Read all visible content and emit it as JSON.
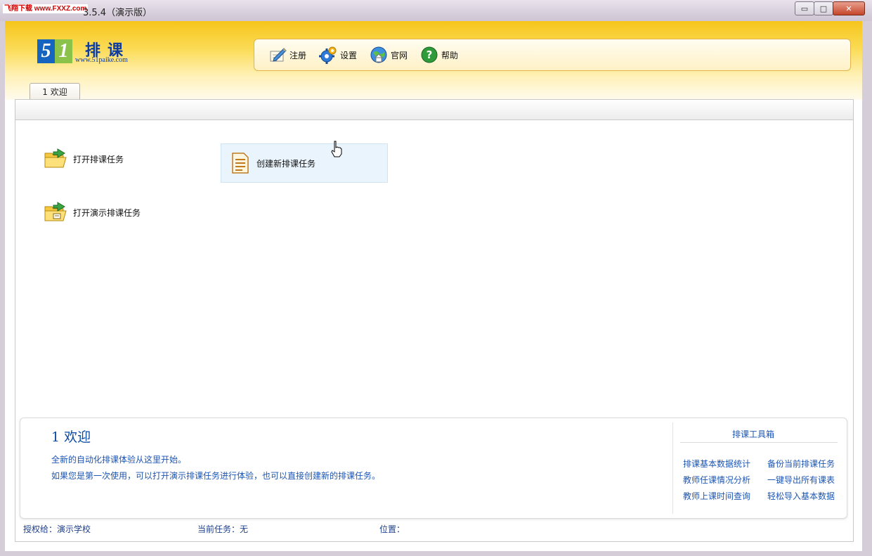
{
  "window": {
    "watermark": "飞翔下载 www.FXXZ.com",
    "title": "3.5.4（演示版）",
    "btn_min": "▭",
    "btn_max": "□",
    "btn_close": "✕"
  },
  "logo": {
    "digit1": "5",
    "digit2": "1",
    "name": "排课",
    "url": "www.51paike.com"
  },
  "toolbar": {
    "items": [
      {
        "label": "注册",
        "icon": "register-pencil-icon"
      },
      {
        "label": "设置",
        "icon": "gear-icon"
      },
      {
        "label": "官网",
        "icon": "globe-home-icon"
      },
      {
        "label": "帮助",
        "icon": "help-icon"
      }
    ]
  },
  "tabs": [
    {
      "label": "1 欢迎",
      "active": true
    }
  ],
  "tasks": {
    "open_task": "打开排课任务",
    "new_task": "创建新排课任务",
    "open_demo": "打开演示排课任务"
  },
  "info": {
    "title": "1  欢迎",
    "line1": "全新的自动化排课体验从这里开始。",
    "line2": "如果您是第一次使用，可以打开演示排课任务进行体验，也可以直接创建新的排课任务。"
  },
  "toolbox": {
    "title": "排课工具箱",
    "links": [
      "排课基本数据统计",
      "备份当前排课任务",
      "教师任课情况分析",
      "一键导出所有课表",
      "教师上课时间查询",
      "轻松导入基本数据"
    ]
  },
  "status": {
    "licensed": "授权给：演示学校",
    "current_task": "当前任务：无",
    "location": "位置："
  },
  "colors": {
    "header_top": "#f6c51b",
    "link_blue": "#1d56b3",
    "title_blue": "#0b4aa6"
  }
}
